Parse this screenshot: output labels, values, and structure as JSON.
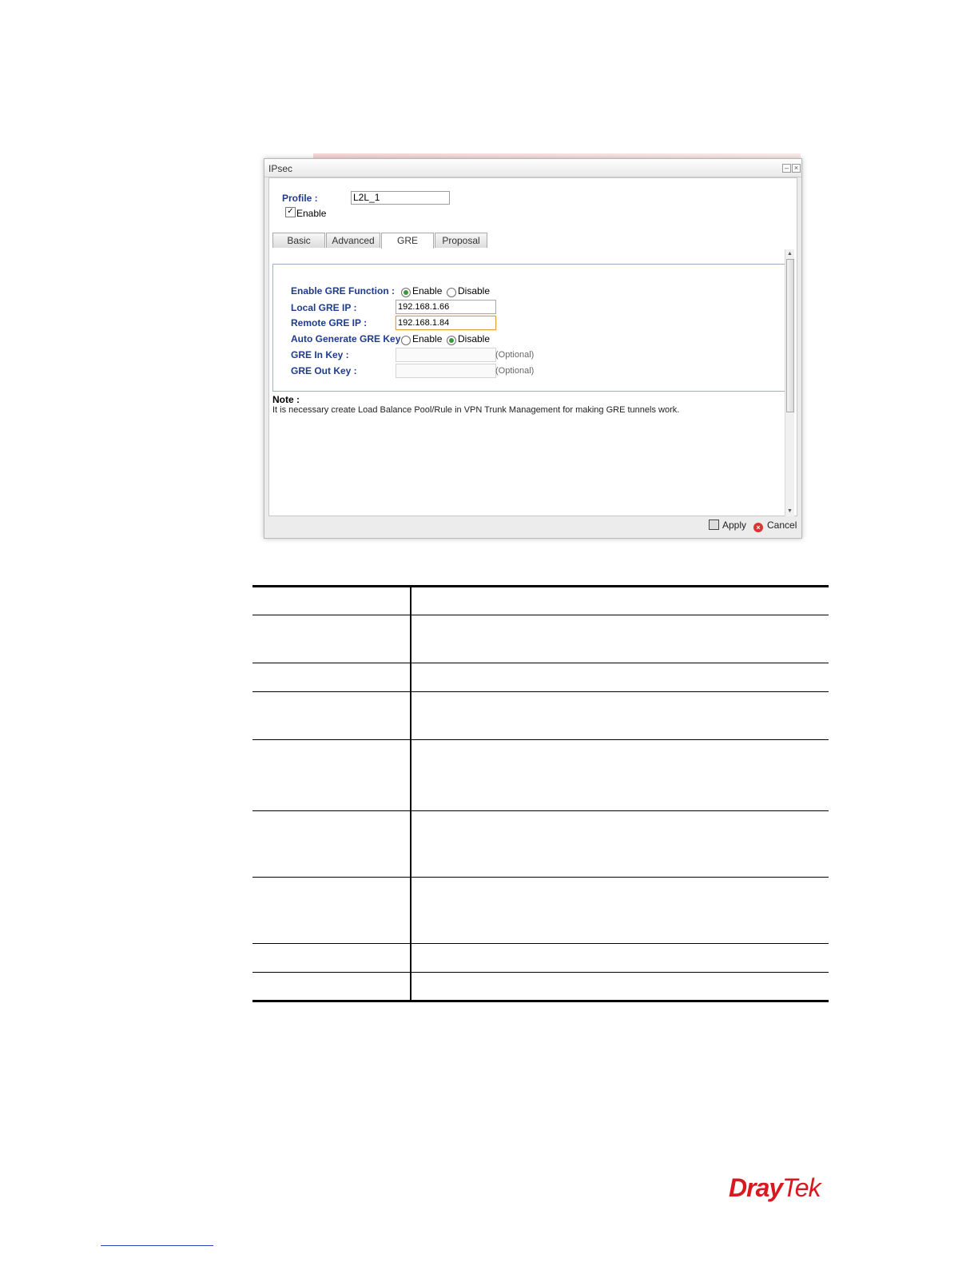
{
  "window": {
    "title": "IPsec",
    "min_label": "–",
    "close_label": "×"
  },
  "profile": {
    "label": "Profile :",
    "value": "L2L_1",
    "enable_label": "Enable",
    "enable_checked": true
  },
  "tabs": [
    {
      "label": "Basic"
    },
    {
      "label": "Advanced"
    },
    {
      "label": "GRE",
      "active": true
    },
    {
      "label": "Proposal"
    }
  ],
  "gre": {
    "enable_label": "Enable GRE Function :",
    "enable_options": [
      "Enable",
      "Disable"
    ],
    "enable_selected": "Enable",
    "local_label": "Local GRE IP :",
    "local_value": "192.168.1.66",
    "remote_label": "Remote GRE IP :",
    "remote_value": "192.168.1.84",
    "auto_key_label": "Auto Generate GRE Key :",
    "auto_key_options": [
      "Enable",
      "Disable"
    ],
    "auto_key_selected": "Disable",
    "in_key_label": "GRE In Key :",
    "in_key_value": "",
    "in_key_hint": "(Optional)",
    "out_key_label": "GRE Out Key :",
    "out_key_value": "",
    "out_key_hint": "(Optional)"
  },
  "note": {
    "title": "Note :",
    "text": "It is necessary create Load Balance Pool/Rule in VPN Trunk Management for making GRE tunnels work."
  },
  "footer": {
    "apply_label": "Apply",
    "cancel_label": "Cancel"
  },
  "brand": {
    "name_part1": "Dray",
    "name_part2": "Tek",
    "color": "#d71920"
  }
}
